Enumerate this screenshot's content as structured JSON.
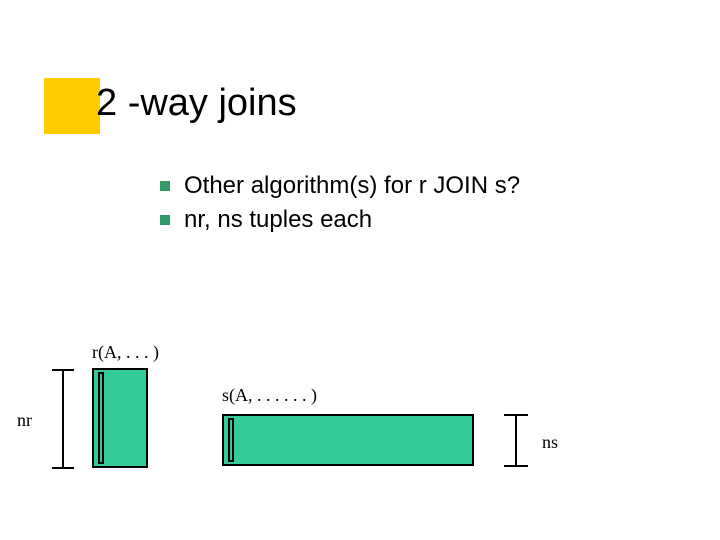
{
  "title": "2 -way joins",
  "bullets": [
    "Other algorithm(s) for  r JOIN s?",
    "nr, ns tuples each"
  ],
  "diagram": {
    "r_label": "r(A, . . . )",
    "nr_label": "nr",
    "s_label": "s(A, . . . . . . )",
    "ns_label": "ns"
  }
}
